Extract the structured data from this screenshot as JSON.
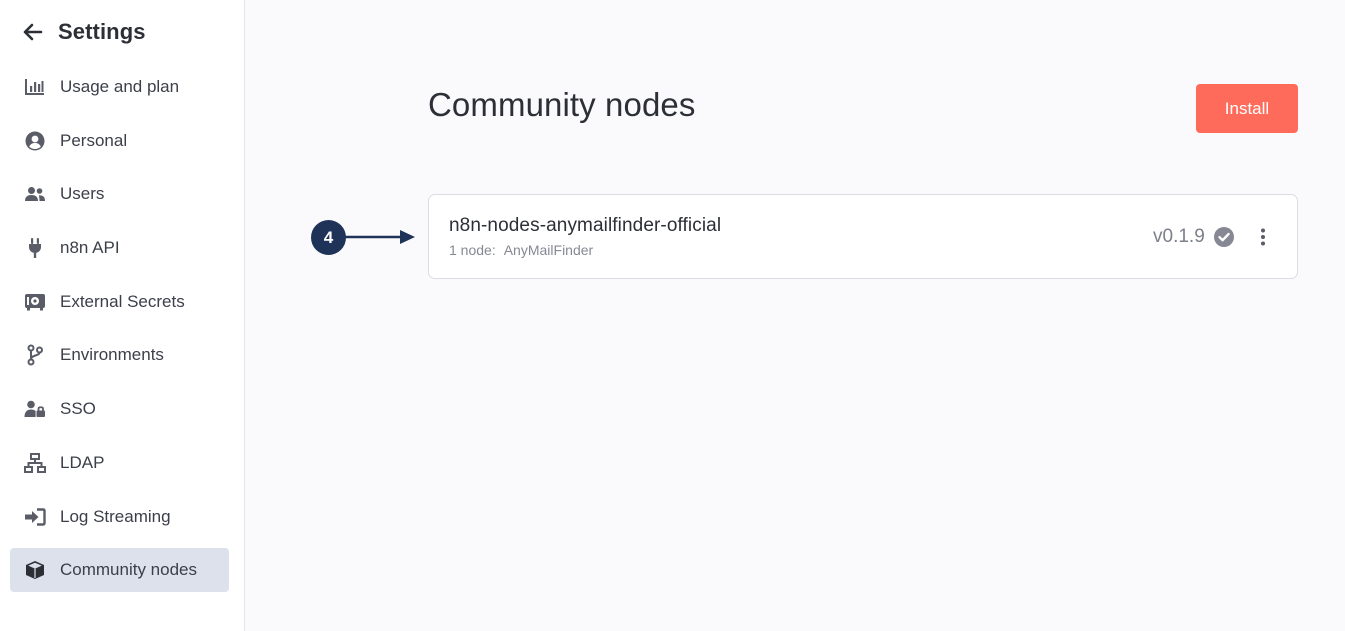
{
  "sidebar": {
    "title": "Settings",
    "items": [
      {
        "label": "Usage and plan",
        "icon": "bar-chart-icon",
        "active": false
      },
      {
        "label": "Personal",
        "icon": "user-circle-icon",
        "active": false
      },
      {
        "label": "Users",
        "icon": "users-icon",
        "active": false
      },
      {
        "label": "n8n API",
        "icon": "plug-icon",
        "active": false
      },
      {
        "label": "External Secrets",
        "icon": "vault-icon",
        "active": false
      },
      {
        "label": "Environments",
        "icon": "git-branch-icon",
        "active": false
      },
      {
        "label": "SSO",
        "icon": "user-lock-icon",
        "active": false
      },
      {
        "label": "LDAP",
        "icon": "network-icon",
        "active": false
      },
      {
        "label": "Log Streaming",
        "icon": "sign-in-icon",
        "active": false
      },
      {
        "label": "Community nodes",
        "icon": "cube-icon",
        "active": true
      }
    ]
  },
  "main": {
    "title": "Community nodes",
    "install_label": "Install",
    "package": {
      "name": "n8n-nodes-anymailfinder-official",
      "node_count": "1 node:",
      "node_names": "AnyMailFinder",
      "version": "v0.1.9"
    }
  },
  "annotation": {
    "step": "4"
  },
  "colors": {
    "accent": "#ff6b5a",
    "active_bg": "#dde1ec",
    "annotation": "#1f3358",
    "icon": "#5a5d68"
  }
}
